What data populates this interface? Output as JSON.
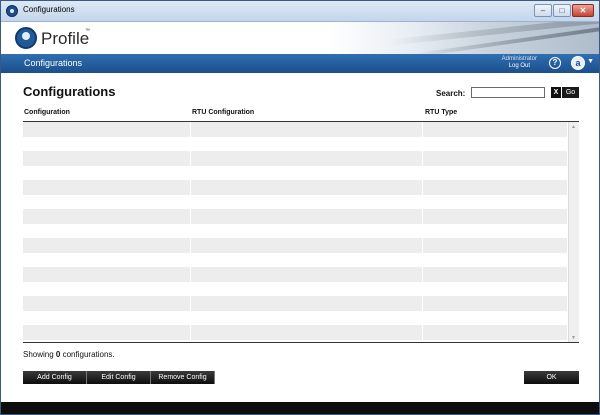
{
  "window": {
    "title": "Configurations"
  },
  "header": {
    "logo_text": "Profile",
    "logo_tm": "™"
  },
  "navbar": {
    "title": "Configurations",
    "user": "Administrator",
    "logout": "Log Out",
    "help_glyph": "?",
    "app_glyph": "a"
  },
  "page": {
    "title": "Configurations"
  },
  "search": {
    "label": "Search:",
    "value": "",
    "clear_label": "X",
    "go_label": "Go"
  },
  "table": {
    "columns": [
      "Configuration",
      "RTU Configuration",
      "RTU Type"
    ],
    "rows": []
  },
  "status": {
    "prefix": "Showing",
    "count": "0",
    "suffix": "configurations."
  },
  "actions": {
    "add": "Add Config",
    "edit": "Edit Config",
    "remove": "Remove Config",
    "ok": "OK"
  },
  "colors": {
    "nav_blue": "#1c4f8a",
    "accent": "#2f6fb2",
    "button_black": "#1a1a1a"
  }
}
